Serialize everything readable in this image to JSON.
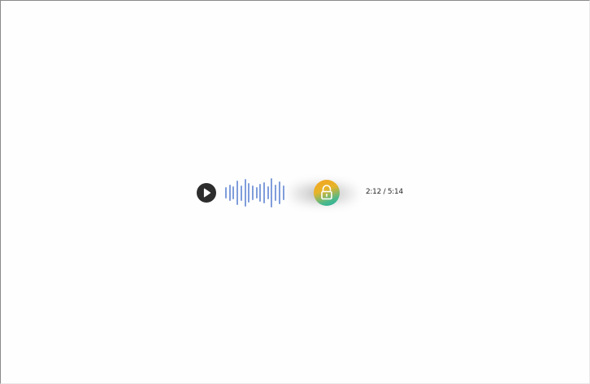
{
  "player": {
    "play_icon": "play-icon",
    "lock_icon": "unlock-icon",
    "current_time": "2:12",
    "separator": " / ",
    "duration": "5:14",
    "colors": {
      "play_button": "#2d2d2d",
      "waveform": "#7f9ddb",
      "lock_gradient_start": "#f6a31e",
      "lock_gradient_end": "#1aae9f"
    },
    "waveform_levels": [
      0.38,
      0.55,
      0.42,
      0.78,
      0.5,
      0.9,
      0.62,
      0.45,
      0.35,
      0.58,
      0.7,
      0.4,
      0.95,
      0.55,
      0.72,
      0.48
    ]
  }
}
